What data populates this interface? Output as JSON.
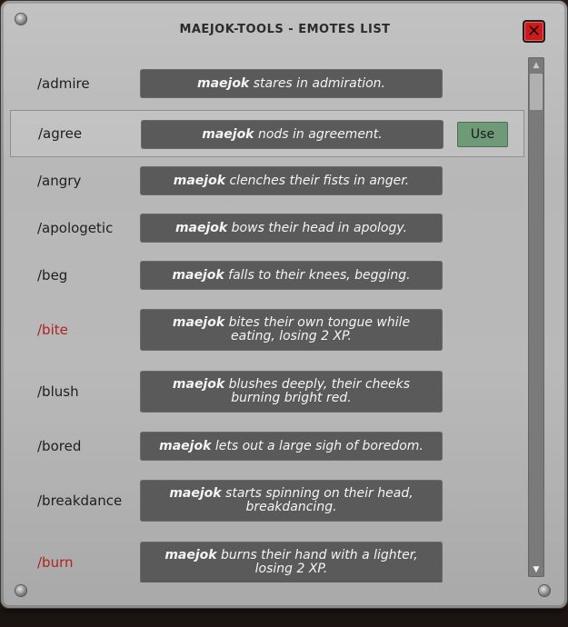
{
  "window": {
    "title": "MAEJOK-TOOLS - EMOTES LIST",
    "close_glyph": "✕"
  },
  "actor": "maejok",
  "use_label": "Use",
  "scrollbar": {
    "up_glyph": "▲",
    "down_glyph": "▼"
  },
  "emotes": [
    {
      "command": "/admire",
      "text": "stares in admiration.",
      "warning": false
    },
    {
      "command": "/agree",
      "text": "nods in agreement.",
      "warning": false,
      "hovered": true
    },
    {
      "command": "/angry",
      "text": "clenches their fists in anger.",
      "warning": false
    },
    {
      "command": "/apologetic",
      "text": "bows their head in apology.",
      "warning": false
    },
    {
      "command": "/beg",
      "text": "falls to their knees, begging.",
      "warning": false
    },
    {
      "command": "/bite",
      "text": "bites their own tongue while eating, losing 2 XP.",
      "warning": true
    },
    {
      "command": "/blush",
      "text": "blushes deeply, their cheeks burning bright red.",
      "warning": false
    },
    {
      "command": "/bored",
      "text": "lets out a large sigh of boredom.",
      "warning": false
    },
    {
      "command": "/breakdance",
      "text": "starts spinning on their head, breakdancing.",
      "warning": false
    },
    {
      "command": "/burn",
      "text": "burns their hand with a lighter, losing 2 XP.",
      "warning": true
    }
  ],
  "colors": {
    "warning_text": "#b02222",
    "use_button": "#6f9a78",
    "close_button": "#cc1b1b"
  }
}
